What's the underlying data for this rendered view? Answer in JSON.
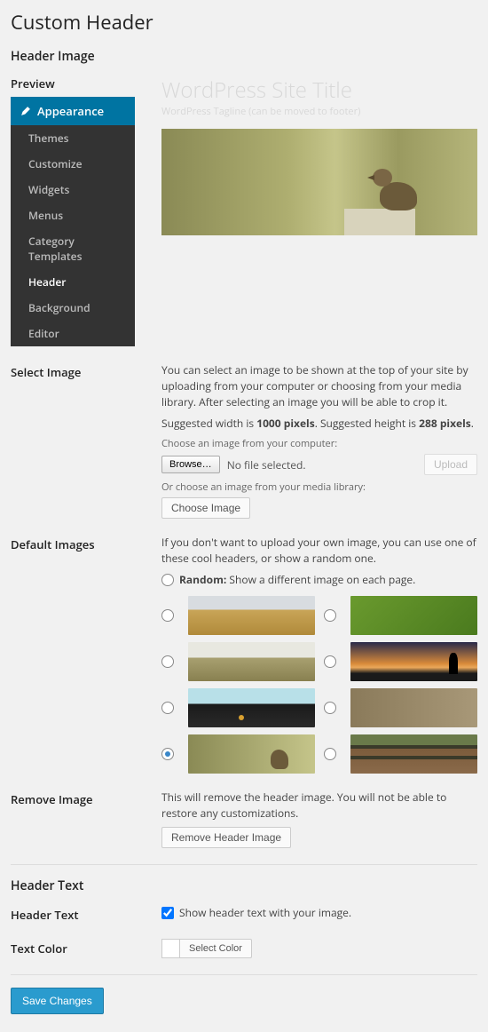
{
  "page_title": "Custom Header",
  "sections": {
    "header_image": "Header Image",
    "preview": "Preview",
    "select_image": "Select Image",
    "default_images": "Default Images",
    "remove_image": "Remove Image",
    "header_text_section": "Header Text",
    "header_text_label": "Header Text",
    "text_color": "Text Color"
  },
  "sidebar": {
    "parent": "Appearance",
    "items": [
      "Themes",
      "Customize",
      "Widgets",
      "Menus",
      "Category Templates",
      "Header",
      "Background",
      "Editor"
    ],
    "current": "Header"
  },
  "preview": {
    "site_title": "WordPress Site Title",
    "tagline": "WordPress Tagline (can be moved to footer)"
  },
  "select_image": {
    "desc1": "You can select an image to be shown at the top of your site by uploading from your computer or choosing from your media library. After selecting an image you will be able to crop it.",
    "desc2_pre": "Suggested width is ",
    "width": "1000 pixels",
    "desc2_mid": ". Suggested height is ",
    "height": "288 pixels",
    "desc2_end": ".",
    "choose_computer": "Choose an image from your computer:",
    "browse": "Browse…",
    "no_file": "No file selected.",
    "upload": "Upload",
    "or_library": "Or choose an image from your media library:",
    "choose_image": "Choose Image"
  },
  "defaults": {
    "desc": "If you don't want to upload your own image, you can use one of these cool headers, or show a random one.",
    "random_label": "Random:",
    "random_desc": "Show a different image on each page."
  },
  "remove": {
    "desc": "This will remove the header image. You will not be able to restore any customizations.",
    "button": "Remove Header Image"
  },
  "header_text": {
    "checkbox_label": "Show header text with your image."
  },
  "text_color": {
    "button": "Select Color"
  },
  "save": "Save Changes"
}
